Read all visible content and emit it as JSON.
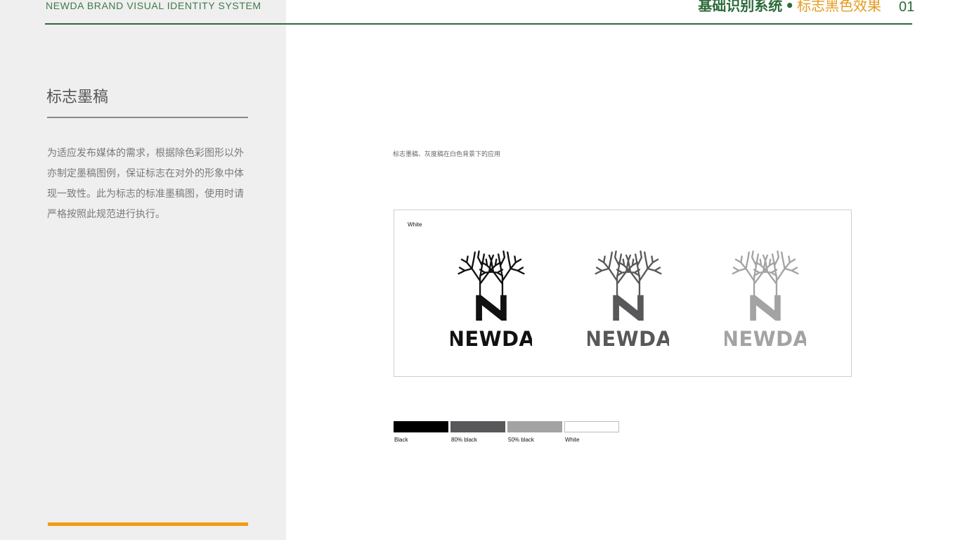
{
  "header": {
    "brand_line": "NEWDA BRAND VISUAL IDENTITY SYSTEM",
    "title_main": "基础识别系统",
    "title_dot": "•",
    "title_sub": "标志黑色效果",
    "page_number": "01"
  },
  "sidebar": {
    "section_title": "标志墨稿",
    "description_lines": [
      "为适应发布媒体的需求，根据除色彩图形以外",
      "亦制定墨稿图例，保证标志在对外的形象中体",
      "现一致性。此为标志的标准墨稿图，使用时请",
      "严格按照此规范进行执行。"
    ]
  },
  "main": {
    "caption": "标志墨稿、灰度稿在白色背景下的应用",
    "panel_label": "White",
    "logos": [
      {
        "wordmark": "NEWDA",
        "color": "#111111"
      },
      {
        "wordmark": "NEWDA",
        "color": "#58585a"
      },
      {
        "wordmark": "NEWDA",
        "color": "#a3a3a3"
      }
    ],
    "swatches": [
      {
        "label": "Black",
        "color": "#000000"
      },
      {
        "label": "80% black",
        "color": "#58585a"
      },
      {
        "label": "50% black",
        "color": "#a3a3a3"
      },
      {
        "label": "White",
        "color": "#ffffff"
      }
    ]
  },
  "colors": {
    "brand_green": "#2d6b3a",
    "accent_orange": "#e49b1f",
    "sidebar_bg": "#efefef"
  }
}
